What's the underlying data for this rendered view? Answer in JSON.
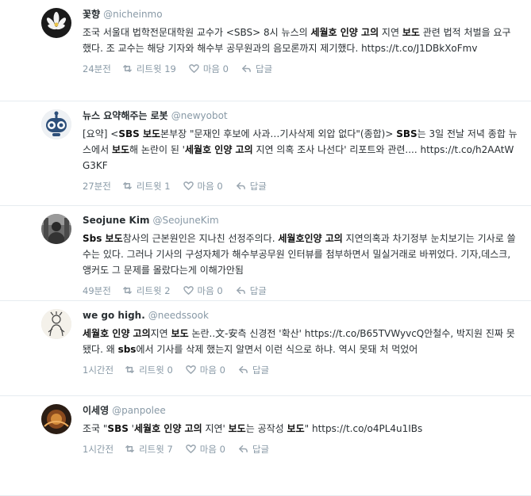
{
  "labels": {
    "retweet": "리트윗",
    "like": "마음",
    "reply": "답글"
  },
  "colors": {
    "name": "#292f33",
    "handle": "#8899a6",
    "icon": "#9aa6b0",
    "divider": "#e6ecf0"
  },
  "tweets": [
    {
      "name": "꽃향",
      "handle": "@nicheinmo",
      "avatar": "flower-avatar",
      "text_parts": [
        {
          "t": "조국 서울대 법학전문대학원 교수가 <SBS> 8시 뉴스의 "
        },
        {
          "t": "세월호 인양 고의",
          "b": true
        },
        {
          "t": " 지연 "
        },
        {
          "t": "보도",
          "b": true
        },
        {
          "t": " 관련 법적 처벌을 요구했다. 조 교수는 해당 기자와 해수부 공무원과의 음모론까지 제기했다. https://t.co/J1DBkXoFmv"
        }
      ],
      "time": "24분전",
      "retweets": "19",
      "likes": "0"
    },
    {
      "name": "뉴스 요약해주는 로봇",
      "handle": "@newyobot",
      "avatar": "robot-avatar",
      "text_parts": [
        {
          "t": "[요약] <"
        },
        {
          "t": "SBS 보도",
          "b": true
        },
        {
          "t": "본부장 \"문재인 후보에 사과…기사삭제 외압 없다\"(종합)> "
        },
        {
          "t": "SBS",
          "b": true
        },
        {
          "t": "는 3일 전날 저녁 종합 뉴스에서 "
        },
        {
          "t": "보도",
          "b": true
        },
        {
          "t": "해 논란이 된 '"
        },
        {
          "t": "세월호 인양 고의",
          "b": true
        },
        {
          "t": " 지연 의혹 조사 나선다' 리포트와 관련.... https://t.co/h2AAtWG3KF"
        }
      ],
      "time": "27분전",
      "retweets": "1",
      "likes": "0"
    },
    {
      "name": "Seojune Kim",
      "handle": "@SeojuneKim",
      "avatar": "photo-avatar",
      "text_parts": [
        {
          "t": "Sbs 보도",
          "b": true
        },
        {
          "t": "참사의 근본원인은 지나친 선정주의다. "
        },
        {
          "t": "세월호인양 고의",
          "b": true
        },
        {
          "t": " 지연의혹과 차기정부 눈치보기는 기사로 쓸수는 있다. 그러나 기사의 구성자체가 해수부공무원 인터뷰를 첨부하면서 밀실거래로 바뀌었다. 기자,데스크,앵커도 그 문제를 몰랐다는게 이해가안됨"
        }
      ],
      "time": "49분전",
      "retweets": "2",
      "likes": "0"
    },
    {
      "name": "we go high.",
      "handle": "@needssook",
      "avatar": "sketch-avatar",
      "text_parts": [
        {
          "t": "세월호 인양 고의",
          "b": true
        },
        {
          "t": "지연 "
        },
        {
          "t": "보도",
          "b": true
        },
        {
          "t": " 논란..文-安측 신경전 '확산' https://t.co/B65TVWyvcQ안철수, 박지원 진짜 못 됐다. 왜 "
        },
        {
          "t": "sbs",
          "b": true
        },
        {
          "t": "에서 기사를 삭제 했는지 알면서 이런 식으로 하냐. 역시 못돼 처 먹었어"
        }
      ],
      "time": "1시간전",
      "retweets": "0",
      "likes": "0"
    },
    {
      "name": "이세영",
      "handle": "@panpolee",
      "avatar": "dark-photo-avatar",
      "text_parts": [
        {
          "t": "조국 \""
        },
        {
          "t": "SBS",
          "b": true
        },
        {
          "t": " '"
        },
        {
          "t": "세월호 인양 고의",
          "b": true
        },
        {
          "t": " 지연' "
        },
        {
          "t": "보도",
          "b": true
        },
        {
          "t": "는 공작성 "
        },
        {
          "t": "보도",
          "b": true
        },
        {
          "t": "\" https://t.co/o4PL4u1IBs"
        }
      ],
      "time": "1시간전",
      "retweets": "7",
      "likes": "0"
    }
  ]
}
